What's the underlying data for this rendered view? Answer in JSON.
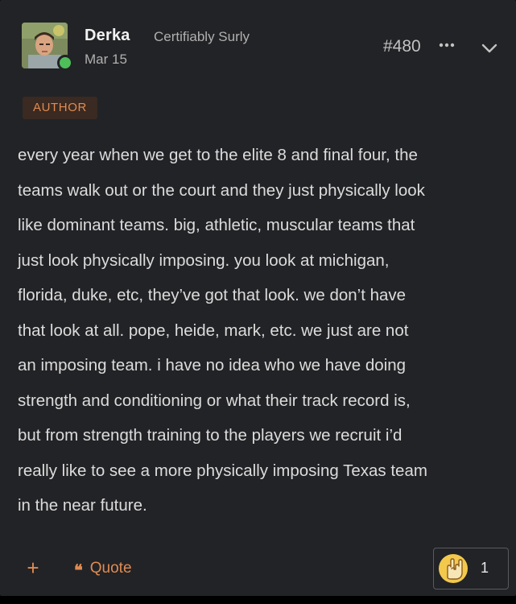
{
  "author": {
    "name": "Derka",
    "title": "Certifiably Surly",
    "online": true,
    "badge": "AUTHOR"
  },
  "post": {
    "date": "Mar 15",
    "number": "#480",
    "body": "every year when we get to the elite 8 and final four, the\nteams walk out or the court and they just physically look\nlike dominant teams. big, athletic, muscular teams that\njust look physically imposing. you look at michigan,\nflorida, duke, etc, they’ve got that look. we don’t have\nthat look at all. pope, heide, mark, etc. we just are not\nan imposing team. i have no idea who we have doing\nstrength and conditioning or what their track record is,\nbut from strength training to the players we recruit i’d\nreally like to see a more physically imposing Texas team\nin the near future."
  },
  "actions": {
    "add_label": "+",
    "quote_icon": "❝",
    "quote_label": "Quote",
    "reaction_icon": "rock-on-hand-icon",
    "reaction_count": "1"
  },
  "colors": {
    "background": "#222326",
    "accent": "#e08b52",
    "text": "#dcdcdc",
    "muted": "#b0b0b0",
    "online": "#4fbf5a",
    "reaction_circle": "#f2c94c"
  }
}
